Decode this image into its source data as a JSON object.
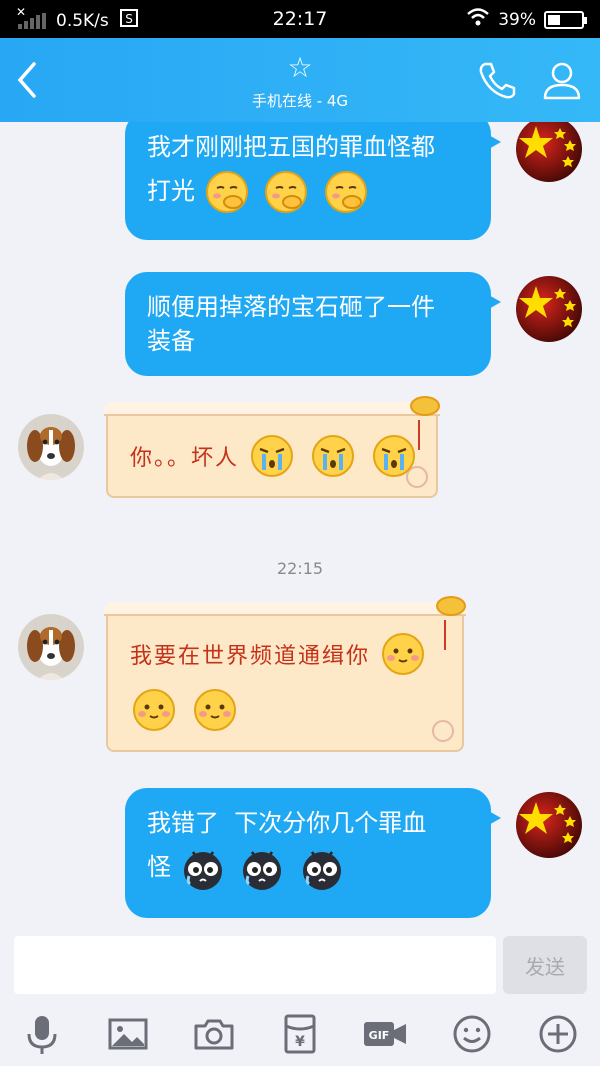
{
  "status_bar": {
    "net_speed": "0.5K/s",
    "time": "22:17",
    "battery": "39%",
    "battery_level": 0.39
  },
  "header": {
    "star": "☆",
    "subtitle": "手机在线 - 4G"
  },
  "messages": [
    {
      "side": "out",
      "text_line1": "我才刚刚把五国的罪血怪都",
      "text_line2": "打光"
    },
    {
      "side": "out",
      "text_line1": "顺便用掉落的宝石砸了一件",
      "text_line2": "装备"
    },
    {
      "side": "in",
      "text_line1": "你。。坏人"
    },
    {
      "timestamp": "22:15"
    },
    {
      "side": "in",
      "text_line1": "我要在世界频道通缉你"
    },
    {
      "side": "out",
      "text_line1": "我错了  下次分你几个罪血",
      "text_line2": "怪"
    }
  ],
  "input": {
    "placeholder": "",
    "send_label": "发送"
  },
  "toolbar": [
    "microphone-icon",
    "image-icon",
    "camera-icon",
    "red-packet-icon",
    "gif-icon",
    "emoji-icon",
    "plus-icon"
  ],
  "colors": {
    "accent": "#28a7f4",
    "bubble_out": "#1fa8f3",
    "bubble_in_bg": "#fde8c8",
    "bubble_in_text": "#c4321a"
  }
}
